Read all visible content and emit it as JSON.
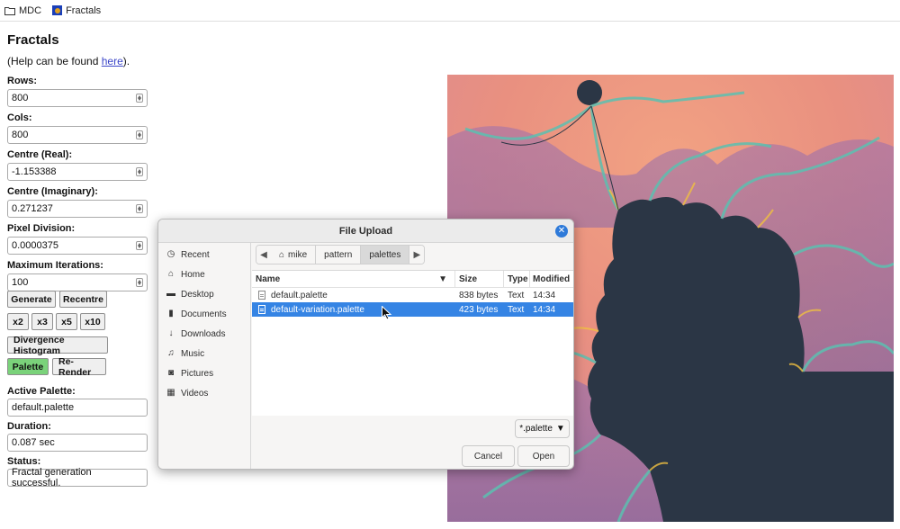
{
  "breadcrumb": {
    "items": [
      {
        "label": "MDC",
        "icon": "folder-icon"
      },
      {
        "label": "Fractals",
        "icon": "fractal-app-icon"
      }
    ]
  },
  "page": {
    "title": "Fractals",
    "help_prefix": "(Help can be found ",
    "help_link": "here",
    "help_suffix": ")."
  },
  "form": {
    "rows_label": "Rows:",
    "rows_value": "800",
    "cols_label": "Cols:",
    "cols_value": "800",
    "centre_real_label": "Centre (Real):",
    "centre_real_value": "-1.153388",
    "centre_imag_label": "Centre (Imaginary):",
    "centre_imag_value": "0.271237",
    "pixel_division_label": "Pixel Division:",
    "pixel_division_value": "0.0000375",
    "max_iter_label": "Maximum Iterations:",
    "max_iter_value": "100"
  },
  "buttons": {
    "generate": "Generate",
    "recentre": "Recentre",
    "x2": "x2",
    "x3": "x3",
    "x5": "x5",
    "x10": "x10",
    "divergence": "Divergence Histogram",
    "palette": "Palette",
    "rerender": "Re-Render"
  },
  "status_area": {
    "active_palette_label": "Active Palette:",
    "active_palette_value": "default.palette",
    "duration_label": "Duration:",
    "duration_value": "0.087 sec",
    "status_label": "Status:",
    "status_value": "Fractal generation successful."
  },
  "dialog": {
    "title": "File Upload",
    "places": [
      {
        "label": "Recent",
        "icon": "clock-icon"
      },
      {
        "label": "Home",
        "icon": "home-icon"
      },
      {
        "label": "Desktop",
        "icon": "desktop-icon"
      },
      {
        "label": "Documents",
        "icon": "document-icon"
      },
      {
        "label": "Downloads",
        "icon": "download-icon"
      },
      {
        "label": "Music",
        "icon": "music-icon"
      },
      {
        "label": "Pictures",
        "icon": "camera-icon"
      },
      {
        "label": "Videos",
        "icon": "film-icon"
      }
    ],
    "path": [
      "mike",
      "pattern",
      "palettes"
    ],
    "columns": {
      "name": "Name",
      "size": "Size",
      "type": "Type",
      "modified": "Modified"
    },
    "files": [
      {
        "name": "default.palette",
        "size": "838 bytes",
        "type": "Text",
        "modified": "14:34"
      },
      {
        "name": "default-variation.palette",
        "size": "423 bytes",
        "type": "Text",
        "modified": "14:34"
      }
    ],
    "filter": "*.palette",
    "cancel": "Cancel",
    "open": "Open"
  },
  "colors": {
    "selection": "#3584e4",
    "palette_active": "#7ad27a",
    "fractal_interior": "#2b3645"
  }
}
